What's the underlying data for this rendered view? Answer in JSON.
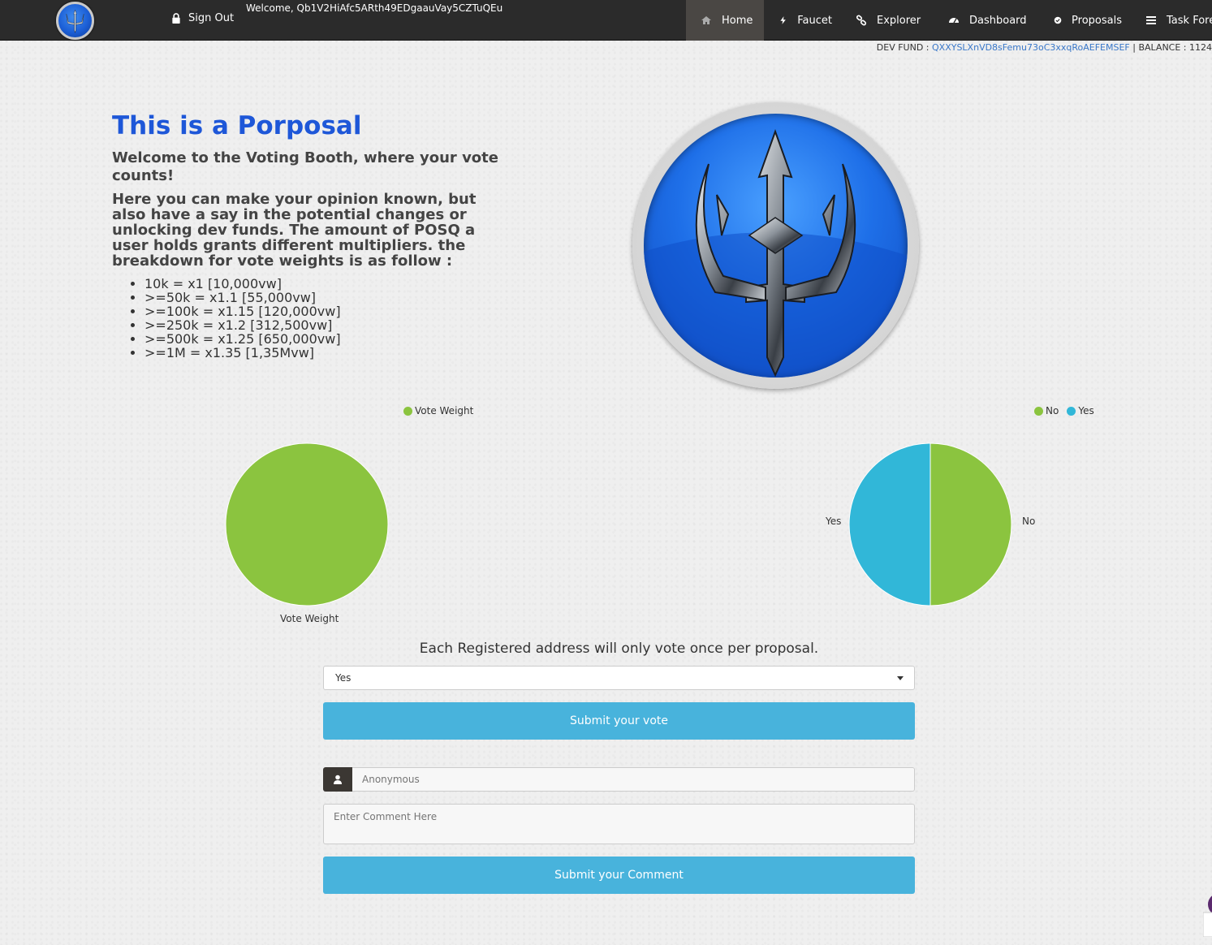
{
  "nav": {
    "signout_label": "Sign Out",
    "welcome_text": "Welcome, Qb1V2HiAfc5ARth49EDgaauVay5CZTuQEu",
    "items": [
      {
        "label": "Home",
        "icon": "home-icon"
      },
      {
        "label": "Faucet",
        "icon": "bolt-icon"
      },
      {
        "label": "Explorer",
        "icon": "link-icon"
      },
      {
        "label": "Dashboard",
        "icon": "dashboard-icon"
      },
      {
        "label": "Proposals",
        "icon": "check-circle-icon"
      },
      {
        "label": "Task Fore",
        "icon": "tasks-icon"
      }
    ]
  },
  "devfund": {
    "label": "DEV FUND : ",
    "address": "QXXYSLXnVD8sFemu73oC3xxqRoAEFEMSEF",
    "separator": " | ",
    "balance": "BALANCE : 1124"
  },
  "intro": {
    "title": "This is a Porposal",
    "lead": "Welcome to the Voting Booth, where your vote counts!",
    "description": "Here you can make your opinion known, but also have a say in the potential changes or unlocking dev funds. The amount of POSQ a user holds grants different multipliers. the breakdown for vote weights is as follow :",
    "tiers": [
      "10k = x1 [10,000vw]",
      ">=50k = x1.1 [55,000vw]",
      ">=100k = x1.15 [120,000vw]",
      ">=250k = x1.2 [312,500vw]",
      ">=500k = x1.25 [650,000vw]",
      ">=1M = x1.35 [1,35Mvw]"
    ]
  },
  "chart_data": [
    {
      "type": "pie",
      "legend": [
        "Vote Weight"
      ],
      "categories": [
        "Vote Weight"
      ],
      "values": [
        1
      ],
      "colors": [
        "#8bc43f"
      ]
    },
    {
      "type": "pie",
      "legend": [
        "No",
        "Yes"
      ],
      "categories": [
        "No",
        "Yes"
      ],
      "values": [
        50,
        50
      ],
      "colors": [
        "#8bc43f",
        "#31b7d8"
      ]
    }
  ],
  "form": {
    "note": "Each Registered address will only vote once per proposal.",
    "selected_option": "Yes",
    "submit_vote_label": "Submit your vote",
    "name_placeholder": "Anonymous",
    "comment_placeholder": "Enter Comment Here",
    "submit_comment_label": "Submit your Comment"
  },
  "colors": {
    "nav_bg": "#2b2b2b",
    "title_blue": "#1e57d8",
    "button_blue": "#48b3dc",
    "pie_green": "#8bc43f",
    "pie_cyan": "#31b7d8"
  }
}
